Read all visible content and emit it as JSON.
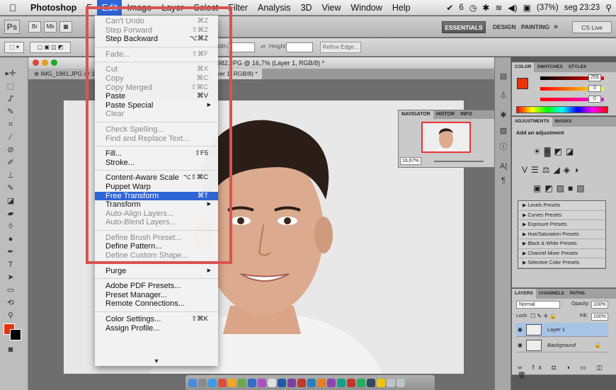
{
  "menubar": {
    "app": "Photoshop",
    "items": [
      "F",
      "Edit",
      "Image",
      "Layer",
      "Select",
      "Filter",
      "Analysis",
      "3D",
      "View",
      "Window",
      "Help"
    ],
    "status": {
      "adobe": "6",
      "battery": "(37%)",
      "clock": "seg 23:23"
    }
  },
  "appbar": {
    "logo": "Ps",
    "essentials": "ESSENTIALS",
    "design": "DESIGN",
    "painting": "PAINTING",
    "more": "»",
    "cslive": "CS Live"
  },
  "options": {
    "width_label": "Width:",
    "height_label": "Height:",
    "refine_label": "Refine Edge..."
  },
  "document": {
    "title": "IMG_1982.JPG @ 16,7% (Layer 1, RGB/8) *",
    "tab1": "IMG_1981.JPG @ 16",
    "tab2": "yer 1, RGB/8) *"
  },
  "navigator": {
    "tabs": [
      "NAVIGATOR",
      "HISTOR",
      "INFO"
    ],
    "zoom": "16,67%"
  },
  "color_panel": {
    "tabs": [
      "COLOR",
      "SWATCHES",
      "STYLES"
    ],
    "r": "255",
    "g": "0",
    "b": "0",
    "fg_color": "#e8320e"
  },
  "adjustments": {
    "tabs": [
      "ADJUSTMENTS",
      "MASKS"
    ],
    "title": "Add an adjustment",
    "presets": [
      "Levels Presets",
      "Curves Presets",
      "Exposure Presets",
      "Hue/Saturation Presets",
      "Black & White Presets",
      "Channel Mixer Presets",
      "Selective Color Presets"
    ]
  },
  "layers": {
    "tabs": [
      "LAYERS",
      "CHANNELS",
      "PATHS"
    ],
    "blend": "Normal",
    "opacity_label": "Opacity:",
    "opacity": "100%",
    "lock_label": "Lock:",
    "fill_label": "Fill:",
    "fill": "100%",
    "rows": [
      {
        "name": "Layer 1"
      },
      {
        "name": "Background"
      }
    ]
  },
  "edit_menu": {
    "undo": "Can't Undo",
    "undo_sc": "⌘Z",
    "step_fwd": "Step Forward",
    "step_fwd_sc": "⇧⌘Z",
    "step_back": "Step Backward",
    "step_back_sc": "⌥⌘Z",
    "fade": "Fade...",
    "fade_sc": "⇧⌘F",
    "cut": "Cut",
    "cut_sc": "⌘X",
    "copy": "Copy",
    "copy_sc": "⌘C",
    "copy_merged": "Copy Merged",
    "copy_merged_sc": "⇧⌘C",
    "paste": "Paste",
    "paste_sc": "⌘V",
    "paste_special": "Paste Special",
    "clear": "Clear",
    "check_spelling": "Check Spelling...",
    "find_replace": "Find and Replace Text...",
    "fill": "Fill...",
    "fill_sc": "⇧F5",
    "stroke": "Stroke...",
    "content_aware": "Content-Aware Scale",
    "content_aware_sc": "⌥⇧⌘C",
    "puppet_warp": "Puppet Warp",
    "free_transform": "Free Transform",
    "free_transform_sc": "⌘T",
    "transform": "Transform",
    "auto_align": "Auto-Align Layers...",
    "auto_blend": "Auto-Blend Layers...",
    "define_brush": "Define Brush Preset...",
    "define_pattern": "Define Pattern...",
    "define_shape": "Define Custom Shape...",
    "purge": "Purge",
    "pdf_presets": "Adobe PDF Presets...",
    "preset_manager": "Preset Manager...",
    "remote": "Remote Connections...",
    "color_settings": "Color Settings...",
    "color_settings_sc": "⇧⌘K",
    "assign_profile": "Assign Profile..."
  }
}
